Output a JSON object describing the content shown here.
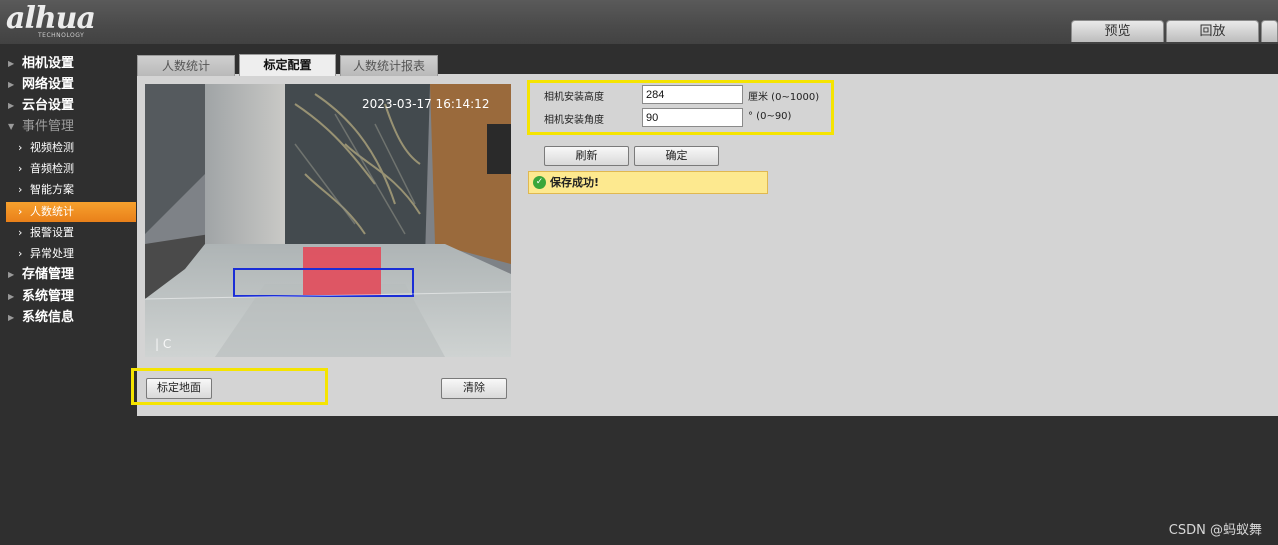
{
  "brand": {
    "logo_text": "alhua",
    "logo_subtext": "TECHNOLOGY"
  },
  "header_tabs": [
    {
      "label": "预览"
    },
    {
      "label": "回放"
    }
  ],
  "sidebar": {
    "items": [
      {
        "label": "相机设置",
        "level": "top"
      },
      {
        "label": "网络设置",
        "level": "top"
      },
      {
        "label": "云台设置",
        "level": "top"
      },
      {
        "label": "事件管理",
        "level": "top",
        "expanded": true
      },
      {
        "label": "视频检测",
        "level": "sub"
      },
      {
        "label": "音频检测",
        "level": "sub"
      },
      {
        "label": "智能方案",
        "level": "sub"
      },
      {
        "label": "人数统计",
        "level": "sub",
        "active": true
      },
      {
        "label": "报警设置",
        "level": "sub"
      },
      {
        "label": "异常处理",
        "level": "sub"
      },
      {
        "label": "存储管理",
        "level": "top"
      },
      {
        "label": "系统管理",
        "level": "top"
      },
      {
        "label": "系统信息",
        "level": "top"
      }
    ]
  },
  "subtabs": [
    {
      "label": "人数统计"
    },
    {
      "label": "标定配置",
      "active": true
    },
    {
      "label": "人数统计报表"
    }
  ],
  "video": {
    "timestamp": "2023-03-17 16:14:12"
  },
  "form": {
    "height_label": "相机安装高度",
    "height_value": "284",
    "height_unit": "厘米 (0~1000)",
    "angle_label": "相机安装角度",
    "angle_value": "90",
    "angle_unit": "° (0~90)"
  },
  "buttons": {
    "refresh": "刷新",
    "confirm": "确定",
    "calibrate_ground": "标定地面",
    "clear": "清除"
  },
  "toast": {
    "message": "保存成功!"
  },
  "watermark": "CSDN @蚂蚁舞",
  "colors": {
    "highlight": "#f5e400",
    "active_nav": "#f08c20",
    "success": "#3aa63a"
  }
}
